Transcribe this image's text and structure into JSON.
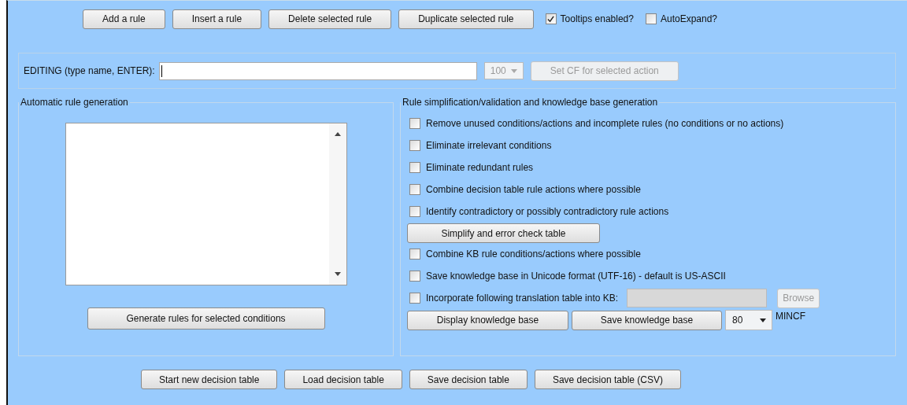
{
  "toolbar": {
    "buttons": [
      "Add a rule",
      "Insert a rule",
      "Delete selected rule",
      "Duplicate selected rule"
    ],
    "checkboxes": [
      {
        "label": "Tooltips enabled?",
        "checked": true
      },
      {
        "label": "AutoExpand?",
        "checked": false
      }
    ]
  },
  "editor": {
    "label": "EDITING (type name, ENTER):",
    "cf_dropdown": {
      "value": "100",
      "disabled": true
    },
    "set_cf_button": {
      "label": "Set CF for selected action",
      "disabled": true
    }
  },
  "auto_generation": {
    "title": "Automatic rule generation",
    "button": "Generate rules for selected conditions"
  },
  "simplification": {
    "title": "Rule simplification/validation and knowledge base generation",
    "options": [
      {
        "kind": "checkbox",
        "label": "Remove unused conditions/actions and incomplete rules (no conditions or no actions)",
        "checked": false
      },
      {
        "kind": "checkbox",
        "label": "Eliminate irrelevant conditions",
        "checked": false
      },
      {
        "kind": "checkbox",
        "label": "Eliminate redundant rules",
        "checked": false
      },
      {
        "kind": "checkbox",
        "label": "Combine decision table rule actions where possible",
        "checked": false
      },
      {
        "kind": "checkbox",
        "label": "Identify contradictory or possibly contradictory rule actions",
        "checked": false
      },
      {
        "kind": "button",
        "label": "Simplify and error check table"
      },
      {
        "kind": "checkbox",
        "label": "Combine KB rule conditions/actions where possible",
        "checked": false
      },
      {
        "kind": "checkbox",
        "label": "Save knowledge base in Unicode format (UTF-16) - default is US-ASCII",
        "checked": false
      },
      {
        "kind": "file",
        "label": "Incorporate following translation table into KB:",
        "checked": false,
        "field_disabled": true,
        "button": {
          "label": "Browse",
          "disabled": true
        }
      }
    ],
    "kb_buttons": [
      "Display knowledge base",
      "Save knowledge base"
    ],
    "mincf_dropdown": {
      "value": "80",
      "disabled": false
    },
    "mincf_label": "MINCF"
  },
  "bottom_buttons": [
    "Start new decision table",
    "Load decision table",
    "Save decision table",
    "Save decision table (CSV)"
  ]
}
